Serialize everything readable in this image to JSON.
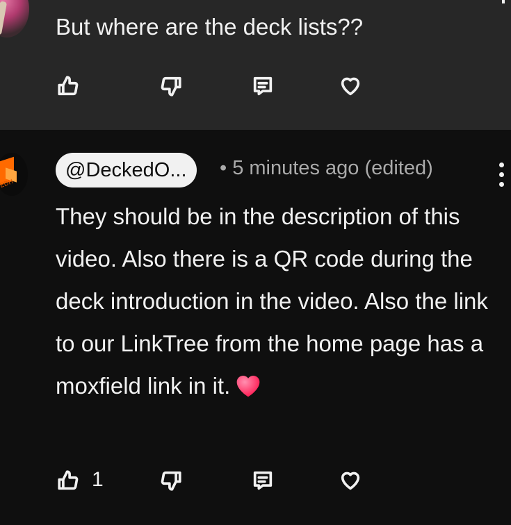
{
  "reply_top": {
    "text": "But where are the deck lists??",
    "actions": [
      "like-icon",
      "dislike-icon",
      "reply-icon",
      "heart-icon"
    ]
  },
  "reply_bottom": {
    "handle": "@DeckedO...",
    "meta": "• 5 minutes ago (edited)",
    "text": "They should be in the description of this video. Also there is a QR code during the deck introduction in the video. Also the link to our LinkTree from the home page has a moxfield link in it.",
    "emoji": "heart-emoji",
    "like_count": "1",
    "actions": [
      "like-icon",
      "dislike-icon",
      "reply-icon",
      "heart-icon"
    ]
  },
  "colors": {
    "highlighted_background": "#272727",
    "background": "#0f0f0f",
    "text": "#f1f1f1",
    "meta_text": "#aaaaaa",
    "heart_emoji": "#ff3b6b"
  }
}
